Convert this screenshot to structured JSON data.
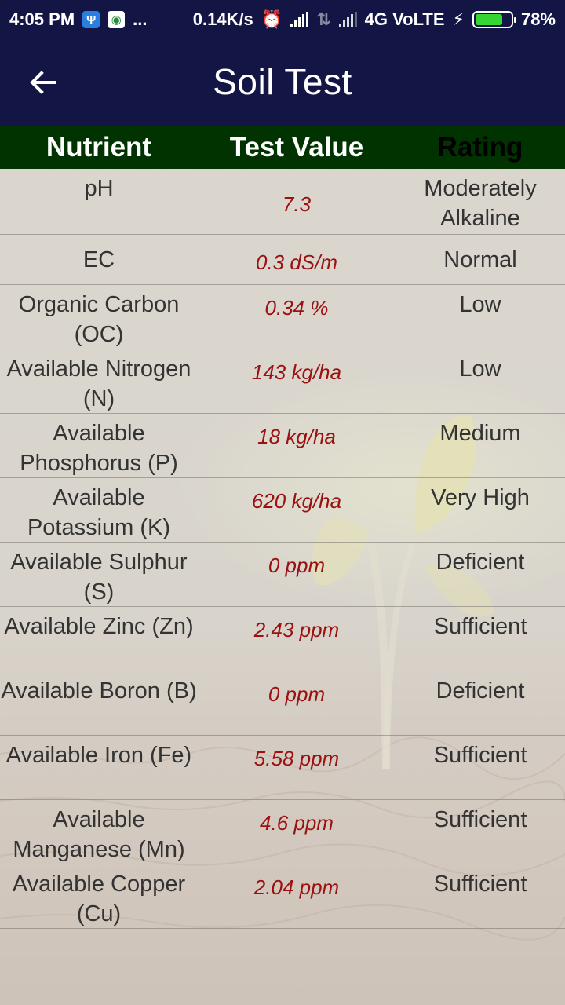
{
  "status_bar": {
    "time": "4:05 PM",
    "more": "...",
    "net_speed": "0.14K/s",
    "network": "4G VoLTE",
    "battery": "78%",
    "battery_level": 0.78
  },
  "app_bar": {
    "title": "Soil Test"
  },
  "table": {
    "headers": [
      "Nutrient",
      "Test Value",
      "Rating"
    ],
    "rows": [
      {
        "nutrient": "pH",
        "value": "7.3",
        "rating": "Moderately Alkaline"
      },
      {
        "nutrient": "EC",
        "value": "0.3 dS/m",
        "rating": "Normal"
      },
      {
        "nutrient": "Organic Carbon (OC)",
        "value": "0.34 %",
        "rating": "Low"
      },
      {
        "nutrient": "Available Nitrogen (N)",
        "value": "143 kg/ha",
        "rating": "Low"
      },
      {
        "nutrient": "Available Phosphorus (P)",
        "value": "18 kg/ha",
        "rating": "Medium"
      },
      {
        "nutrient": "Available Potassium (K)",
        "value": "620 kg/ha",
        "rating": "Very High"
      },
      {
        "nutrient": "Available Sulphur (S)",
        "value": "0 ppm",
        "rating": "Deficient"
      },
      {
        "nutrient": "Available Zinc (Zn)",
        "value": "2.43 ppm",
        "rating": "Sufficient"
      },
      {
        "nutrient": "Available Boron (B)",
        "value": "0 ppm",
        "rating": "Deficient"
      },
      {
        "nutrient": "Available Iron (Fe)",
        "value": "5.58 ppm",
        "rating": "Sufficient"
      },
      {
        "nutrient": "Available Manganese (Mn)",
        "value": "4.6 ppm",
        "rating": "Sufficient"
      },
      {
        "nutrient": "Available Copper (Cu)",
        "value": "2.04 ppm",
        "rating": "Sufficient"
      }
    ]
  },
  "colors": {
    "app_bar": "#131545",
    "header_row": "#003300",
    "value_text": "#9b1111"
  },
  "icons": {
    "back": "arrow-left-icon",
    "usb": "usb-icon",
    "maps": "maps-icon",
    "alarm": "alarm-icon",
    "signal": "signal-icon",
    "charging": "charging-icon",
    "battery": "battery-icon"
  }
}
